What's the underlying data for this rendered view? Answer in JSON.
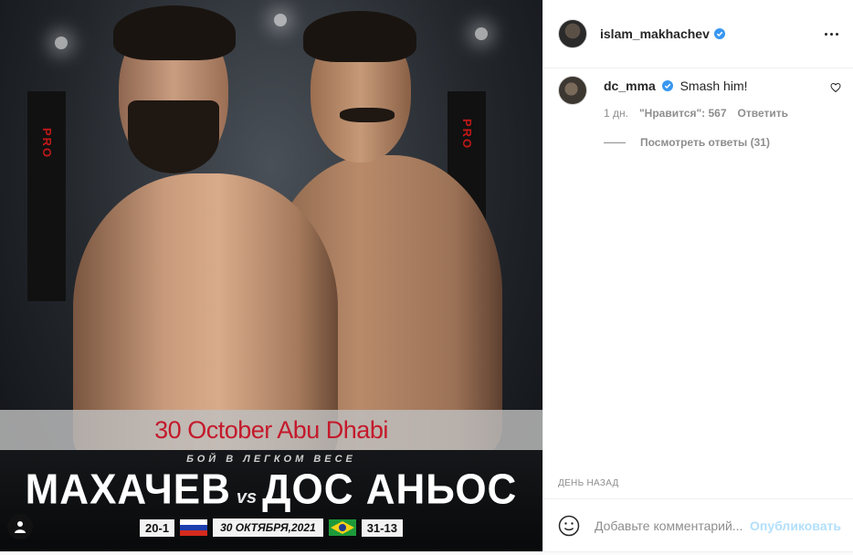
{
  "poster": {
    "date_banner": "30 October Abu Dhabi",
    "subtitle": "БОЙ В ЛЕГКОМ ВЕСЕ",
    "fighter_left": "МАХАЧЕВ",
    "vs": "vs",
    "fighter_right": "ДОС АНЬОС",
    "record_left": "20-1",
    "event_date": "30 ОКТЯБРЯ,2021",
    "record_right": "31-13",
    "cage_brand": "PRO",
    "colors": {
      "date_banner_text": "#c4192b",
      "band_bg": "#bebebe"
    }
  },
  "header": {
    "username": "islam_makhachev",
    "verified_icon": "verified-badge-icon",
    "more_icon": "more-options-icon"
  },
  "comment": {
    "username": "dc_mma",
    "text": "Smash him!",
    "age": "1 дн.",
    "likes": "\"Нравится\": 567",
    "reply": "Ответить",
    "view_replies": "Посмотреть ответы (31)"
  },
  "post_timestamp": "ДЕНЬ НАЗАД",
  "add_comment": {
    "placeholder": "Добавьте комментарий...",
    "post_label": "Опубликовать"
  },
  "colors": {
    "verified": "#3897f0",
    "post_button": "#b2dffc"
  }
}
